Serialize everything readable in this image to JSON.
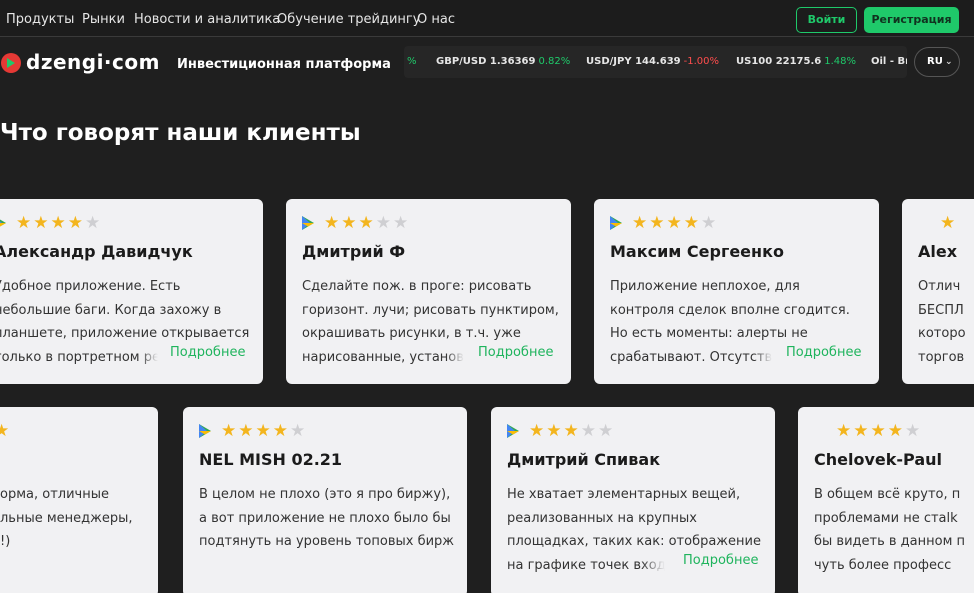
{
  "nav": {
    "items": [
      "Продукты",
      "Рынки",
      "Новости и аналитика",
      "Обучение трейдингу",
      "О нас"
    ],
    "login": "Войти",
    "register": "Регистрация"
  },
  "brand": {
    "logo": "dzengi·com",
    "tagline": "Инвестиционная платформа"
  },
  "ticker": [
    {
      "label": "",
      "value": "",
      "change": "%"
    },
    {
      "label": "GBP/USD",
      "value": "1.36369",
      "change": "0.82%"
    },
    {
      "label": "USD/JPY",
      "value": "144.639",
      "change": "-1.00%"
    },
    {
      "label": "US100",
      "value": "22175.6",
      "change": "1.48%"
    },
    {
      "label": "Oil - Br",
      "value": "",
      "change": ""
    }
  ],
  "language": "RU",
  "reviews": {
    "title": "Что говорят наши клиенты",
    "more_label": "Подробнее",
    "row1": [
      {
        "source": "google-play",
        "stars": 4,
        "name": "Александр Давидчук",
        "text": "Удобное приложение. Есть\nнебольшие баги. Когда захожу в\nпланшете, приложение открывается\nтолько в портретном ре"
      },
      {
        "source": "google-play",
        "stars": 3,
        "name": "Дмитрий Ф",
        "text": "Сделайте пож. в проге: рисовать\nгоризонт. лучи; рисовать пунктиром,\nокрашивать рисунки, в т.ч. уже\nнарисованные, установ"
      },
      {
        "source": "google-play",
        "stars": 4,
        "name": "Максим Сергеенко",
        "text": "Приложение неплохое, для\nконтроля сделок вполне сгодится.\nНо есть моменты: алерты не\nсрабатывают. Отсутству"
      },
      {
        "source": "apple",
        "stars": 1,
        "name": "Alex",
        "text": "Отлич\nБЕСПЛ\nкоторо\nторгов"
      }
    ],
    "row2": [
      {
        "source": "",
        "stars": 1,
        "name": "",
        "text": "орма, отличные\nльные менеджеры,\n!)"
      },
      {
        "source": "google-play",
        "stars": 4,
        "name": "NEL MISH 02.21",
        "text": "В целом не плохо (это я про биржу),\nа вот приложение не плохо было бы\nподтянуть на уровень топовых бирж"
      },
      {
        "source": "google-play",
        "stars": 3,
        "name": "Дмитрий Спивак",
        "text": "Не хватает элементарных вещей,\nреализованных на крупных\nплощадках, таких как: отображение\nна графике точек входа"
      },
      {
        "source": "apple",
        "stars": 4,
        "name": "Chelovek-Paul",
        "text": "В общем всё круто, п\nпроблемами не стalk\nбы видеть в данном п\nчуть более професс"
      }
    ]
  }
}
